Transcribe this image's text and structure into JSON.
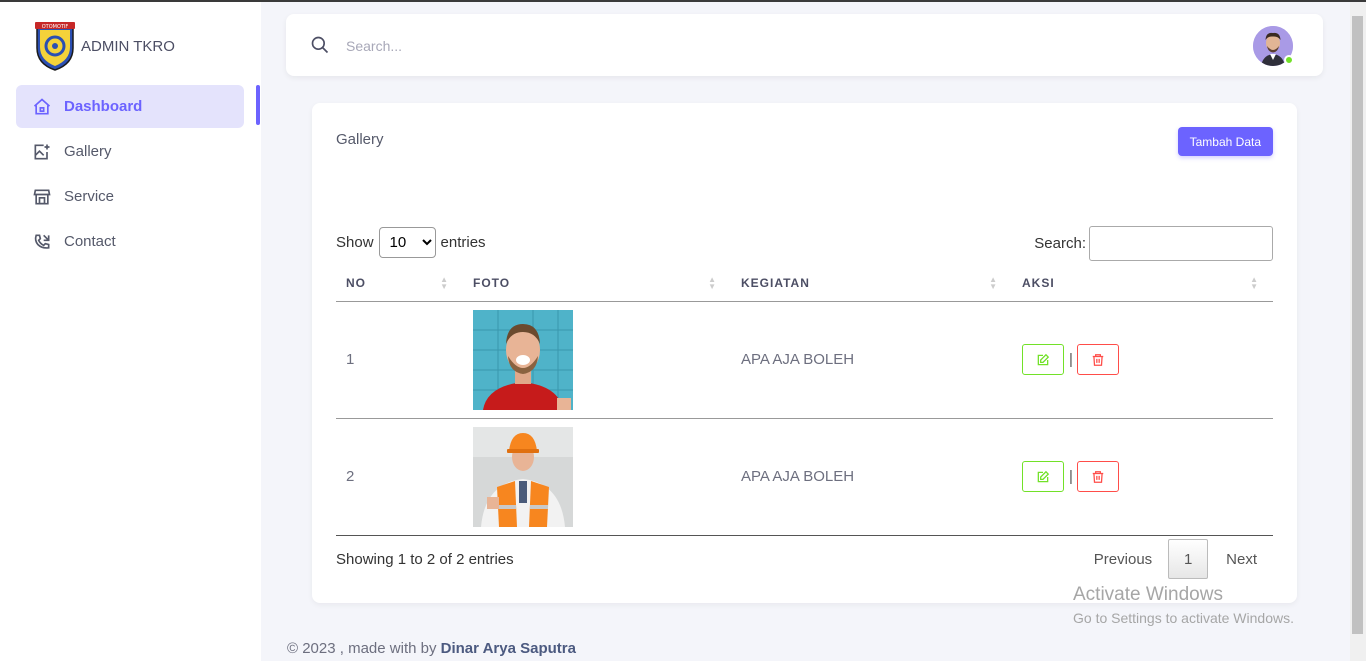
{
  "brand": {
    "title": "ADMIN TKRO",
    "logo_text": "OTOMOTIF"
  },
  "sidebar": {
    "items": [
      {
        "label": "Dashboard",
        "icon": "home-icon",
        "active": true
      },
      {
        "label": "Gallery",
        "icon": "image-add-icon",
        "active": false
      },
      {
        "label": "Service",
        "icon": "store-icon",
        "active": false
      },
      {
        "label": "Contact",
        "icon": "phone-call-icon",
        "active": false
      }
    ]
  },
  "topbar": {
    "search_placeholder": "Search...",
    "search_icon": "search-icon",
    "avatar": "user-avatar"
  },
  "card": {
    "title": "Gallery",
    "add_button": "Tambah Data",
    "show_label": "Show",
    "entries_label": "entries",
    "page_size": "10",
    "search_label": "Search:",
    "columns": [
      "NO",
      "FOTO",
      "KEGIATAN",
      "AKSI"
    ],
    "rows": [
      {
        "no": "1",
        "foto": "photo-man-red-shirt",
        "kegiatan": "APA AJA BOLEH"
      },
      {
        "no": "2",
        "foto": "photo-worker-hardhat",
        "kegiatan": "APA AJA BOLEH"
      }
    ],
    "action_separator": "|",
    "info": "Showing 1 to 2 of 2 entries",
    "pager": {
      "previous": "Previous",
      "page": "1",
      "next": "Next"
    }
  },
  "footer": {
    "prefix": "© 2023 , made with by",
    "author": "Dinar Arya Saputra"
  },
  "watermark": {
    "line1": "Activate Windows",
    "line2": "Go to Settings to activate Windows."
  },
  "colors": {
    "accent": "#6c63ff",
    "edit": "#72e128",
    "delete": "#ff4d49"
  }
}
